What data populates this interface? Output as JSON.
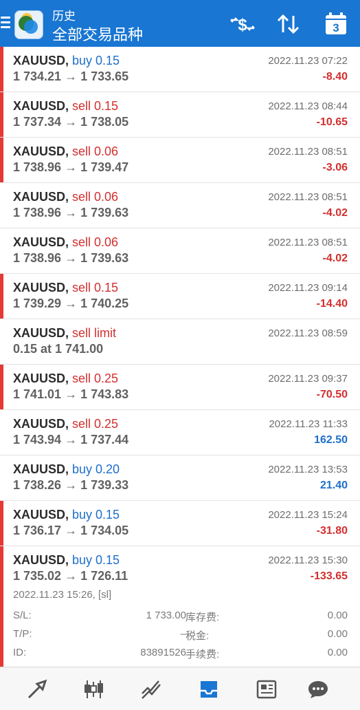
{
  "header": {
    "subtitle": "历史",
    "title": "全部交易品种"
  },
  "calendar_day": "3",
  "colors": {
    "header": "#1976d2",
    "loss": "#d32f2f",
    "profit": "#1e6fc9",
    "buy": "#1e6fc9",
    "sell": "#d32f2f",
    "active_tab": "#1976d2"
  },
  "orders": [
    {
      "symbol": "XAUUSD,",
      "type": "buy 0.15",
      "side": "buy",
      "prices": "1 734.21 → 1 733.65",
      "time": "2022.11.23 07:22",
      "profit": "-8.40",
      "sign": "neg",
      "marked": true
    },
    {
      "symbol": "XAUUSD,",
      "type": "sell 0.15",
      "side": "sell",
      "prices": "1 737.34 → 1 738.05",
      "time": "2022.11.23 08:44",
      "profit": "-10.65",
      "sign": "neg",
      "marked": true
    },
    {
      "symbol": "XAUUSD,",
      "type": "sell 0.06",
      "side": "sell",
      "prices": "1 738.96 → 1 739.47",
      "time": "2022.11.23 08:51",
      "profit": "-3.06",
      "sign": "neg",
      "marked": true
    },
    {
      "symbol": "XAUUSD,",
      "type": "sell 0.06",
      "side": "sell",
      "prices": "1 738.96 → 1 739.63",
      "time": "2022.11.23 08:51",
      "profit": "-4.02",
      "sign": "neg",
      "marked": false
    },
    {
      "symbol": "XAUUSD,",
      "type": "sell 0.06",
      "side": "sell",
      "prices": "1 738.96 → 1 739.63",
      "time": "2022.11.23 08:51",
      "profit": "-4.02",
      "sign": "neg",
      "marked": false
    },
    {
      "symbol": "XAUUSD,",
      "type": "sell 0.15",
      "side": "sell",
      "prices": "1 739.29 → 1 740.25",
      "time": "2022.11.23 09:14",
      "profit": "-14.40",
      "sign": "neg",
      "marked": true
    },
    {
      "symbol": "XAUUSD,",
      "type": "sell limit",
      "side": "sell",
      "prices": "0.15 at 1 741.00",
      "time": "2022.11.23 08:59",
      "profit": "",
      "sign": "neg",
      "marked": false
    },
    {
      "symbol": "XAUUSD,",
      "type": "sell 0.25",
      "side": "sell",
      "prices": "1 741.01 → 1 743.83",
      "time": "2022.11.23 09:37",
      "profit": "-70.50",
      "sign": "neg",
      "marked": true
    },
    {
      "symbol": "XAUUSD,",
      "type": "sell 0.25",
      "side": "sell",
      "prices": "1 743.94 → 1 737.44",
      "time": "2022.11.23 11:33",
      "profit": "162.50",
      "sign": "pos",
      "marked": false
    },
    {
      "symbol": "XAUUSD,",
      "type": "buy 0.20",
      "side": "buy",
      "prices": "1 738.26 → 1 739.33",
      "time": "2022.11.23 13:53",
      "profit": "21.40",
      "sign": "pos",
      "marked": false
    },
    {
      "symbol": "XAUUSD,",
      "type": "buy 0.15",
      "side": "buy",
      "prices": "1 736.17 → 1 734.05",
      "time": "2022.11.23 15:24",
      "profit": "-31.80",
      "sign": "neg",
      "marked": true
    }
  ],
  "expanded": {
    "symbol": "XAUUSD,",
    "type": "buy 0.15",
    "side": "buy",
    "prices": "1 735.02 → 1 726.11",
    "time": "2022.11.23 15:30",
    "profit": "-133.65",
    "sign": "neg",
    "marked": true,
    "open_info": "2022.11.23 15:26, [sl]",
    "rows": [
      {
        "k1": "S/L:",
        "v1": "1 733.00",
        "k2": "库存费:",
        "v2": "0.00"
      },
      {
        "k1": "T/P:",
        "v1": "–",
        "k2": "税金:",
        "v2": "0.00"
      },
      {
        "k1": "ID:",
        "v1": "83891526",
        "k2": "手续费:",
        "v2": "0.00"
      }
    ]
  },
  "nav": [
    "trade-icon",
    "chart-candles-icon",
    "trade-graph-icon",
    "history-inbox-icon",
    "news-icon",
    "chat-icon"
  ]
}
